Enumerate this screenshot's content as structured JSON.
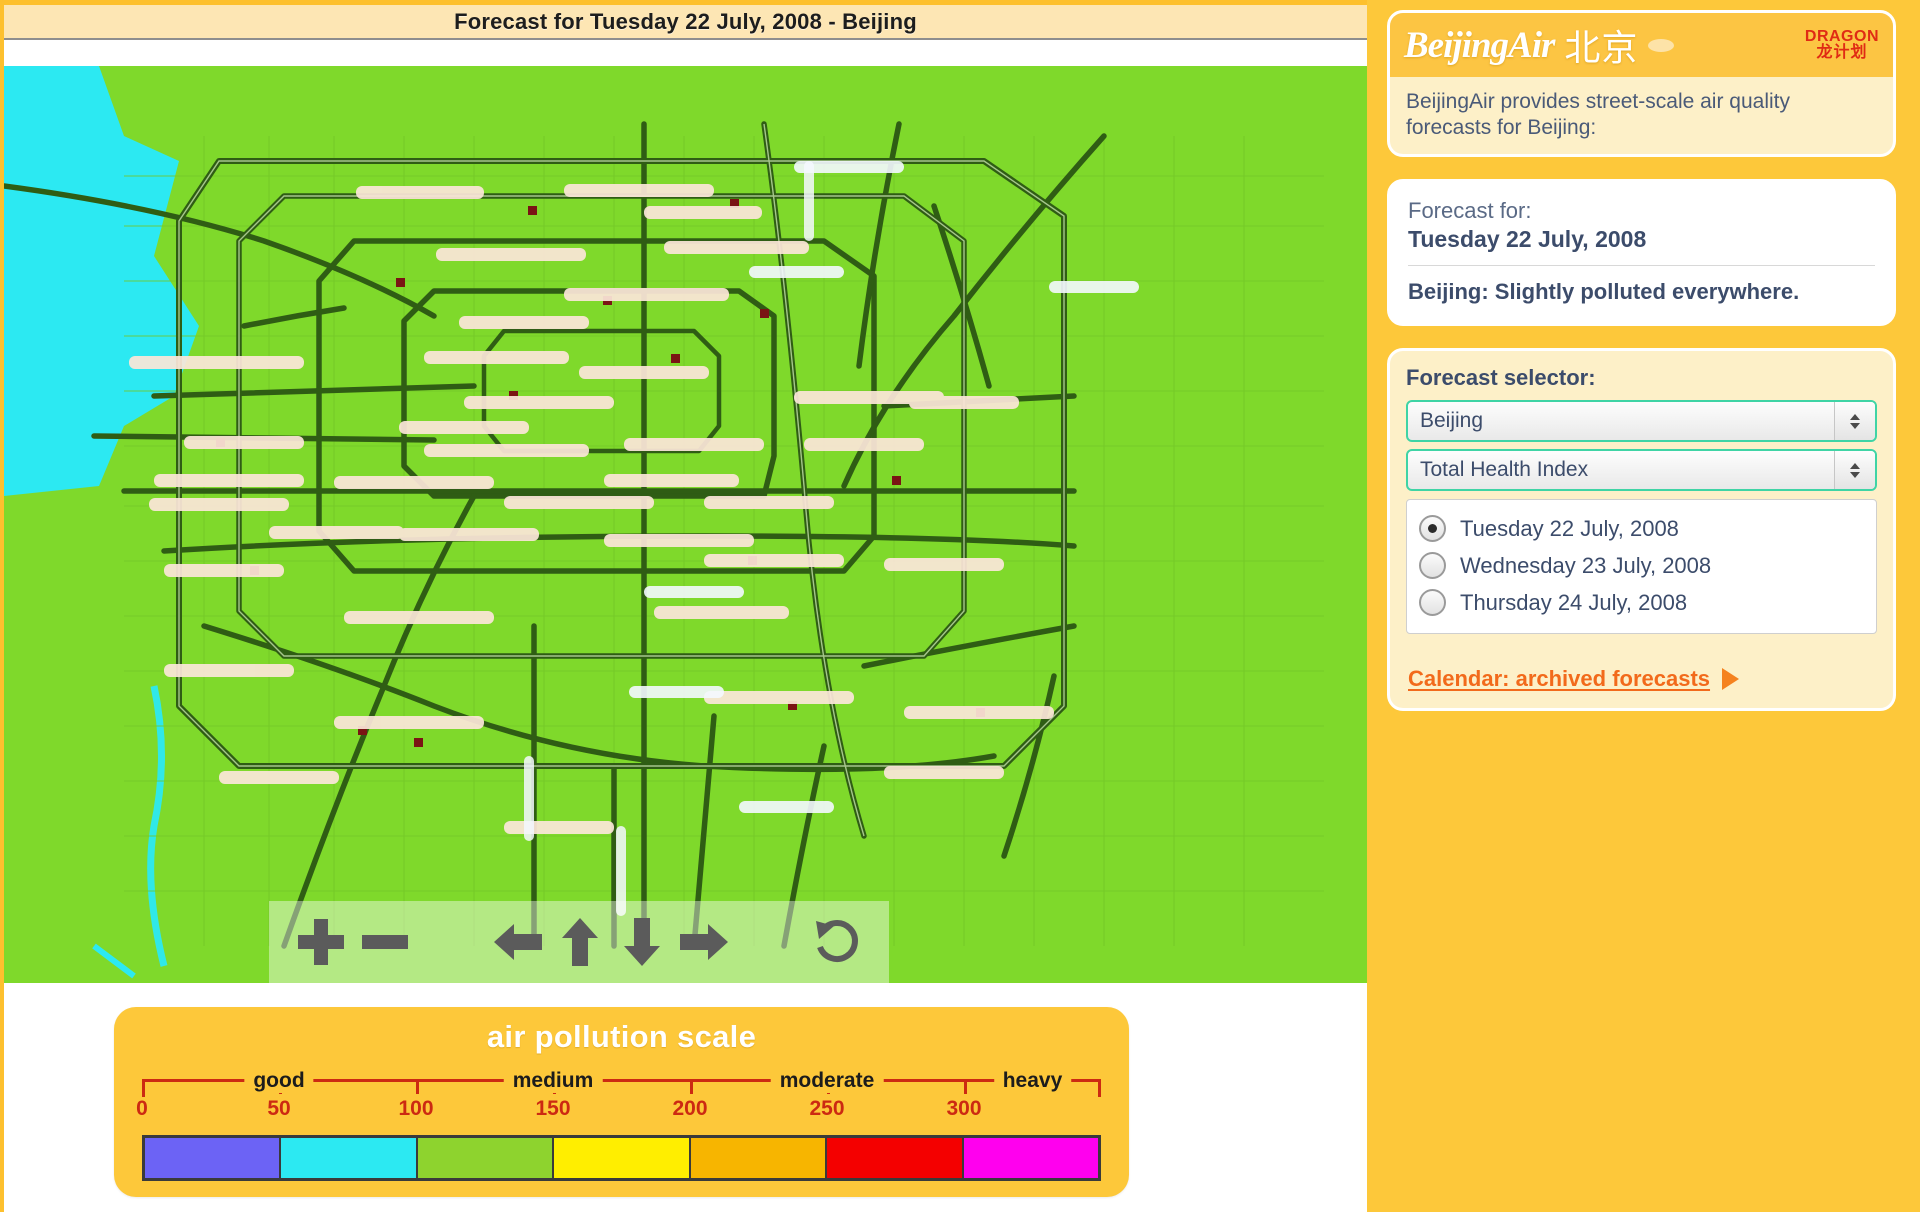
{
  "page": {
    "title": "Forecast for Tuesday 22 July, 2008 - Beijing"
  },
  "map": {
    "land_color": "#7fd92b",
    "water_color": "#2ce9f2",
    "road_color": "#2f5d14",
    "controls": [
      {
        "name": "zoom-in",
        "glyph": "+"
      },
      {
        "name": "zoom-out",
        "glyph": "−"
      },
      {
        "name": "pan-left",
        "glyph": "←"
      },
      {
        "name": "pan-up",
        "glyph": "↑"
      },
      {
        "name": "pan-down",
        "glyph": "↓"
      },
      {
        "name": "pan-right",
        "glyph": "→"
      },
      {
        "name": "reset-view",
        "glyph": "↺"
      }
    ]
  },
  "legend": {
    "title": "air pollution scale",
    "categories": [
      "good",
      "medium",
      "moderate",
      "heavy"
    ],
    "ticks": [
      "0",
      "50",
      "100",
      "150",
      "200",
      "250",
      "300"
    ],
    "colors": [
      "#6c63f5",
      "#2ce9f2",
      "#8ed32e",
      "#ffee00",
      "#f7b500",
      "#f40000",
      "#ff00ee"
    ]
  },
  "sidebar": {
    "brand": {
      "name_en": "BeijingAir",
      "name_cn": "北京",
      "partner_line1": "DRAGON",
      "partner_line2": "龙计划"
    },
    "blurb": "BeijingAir provides street-scale air quality forecasts for Beijing:",
    "forecast": {
      "label": "Forecast for:",
      "date": "Tuesday 22 July, 2008",
      "status": "Beijing: Slightly polluted everywhere."
    },
    "selector": {
      "title": "Forecast selector:",
      "city_value": "Beijing",
      "index_value": "Total Health Index",
      "days": [
        {
          "label": "Tuesday 22 July, 2008",
          "selected": true
        },
        {
          "label": "Wednesday 23 July, 2008",
          "selected": false
        },
        {
          "label": "Thursday 24 July, 2008",
          "selected": false
        }
      ],
      "calendar_link": "Calendar: archived forecasts"
    }
  },
  "chart_data": {
    "type": "heatmap",
    "title": "air pollution scale",
    "xlabel": "Total Health Index",
    "categories": [
      "good",
      "medium",
      "moderate",
      "heavy"
    ],
    "category_ranges": [
      [
        0,
        100
      ],
      [
        100,
        200
      ],
      [
        200,
        300
      ],
      [
        300,
        350
      ]
    ],
    "tick_values": [
      0,
      50,
      100,
      150,
      200,
      250,
      300
    ],
    "bins": [
      {
        "range": [
          0,
          50
        ],
        "color": "#6c63f5"
      },
      {
        "range": [
          50,
          100
        ],
        "color": "#2ce9f2"
      },
      {
        "range": [
          100,
          150
        ],
        "color": "#8ed32e"
      },
      {
        "range": [
          150,
          200
        ],
        "color": "#ffee00"
      },
      {
        "range": [
          200,
          250
        ],
        "color": "#f7b500"
      },
      {
        "range": [
          250,
          300
        ],
        "color": "#f40000"
      },
      {
        "range": [
          300,
          350
        ],
        "color": "#ff00ee"
      }
    ],
    "map_value_band": [
      100,
      150
    ],
    "map_value_label": "Slightly polluted",
    "grid": false,
    "legend_position": "bottom"
  }
}
